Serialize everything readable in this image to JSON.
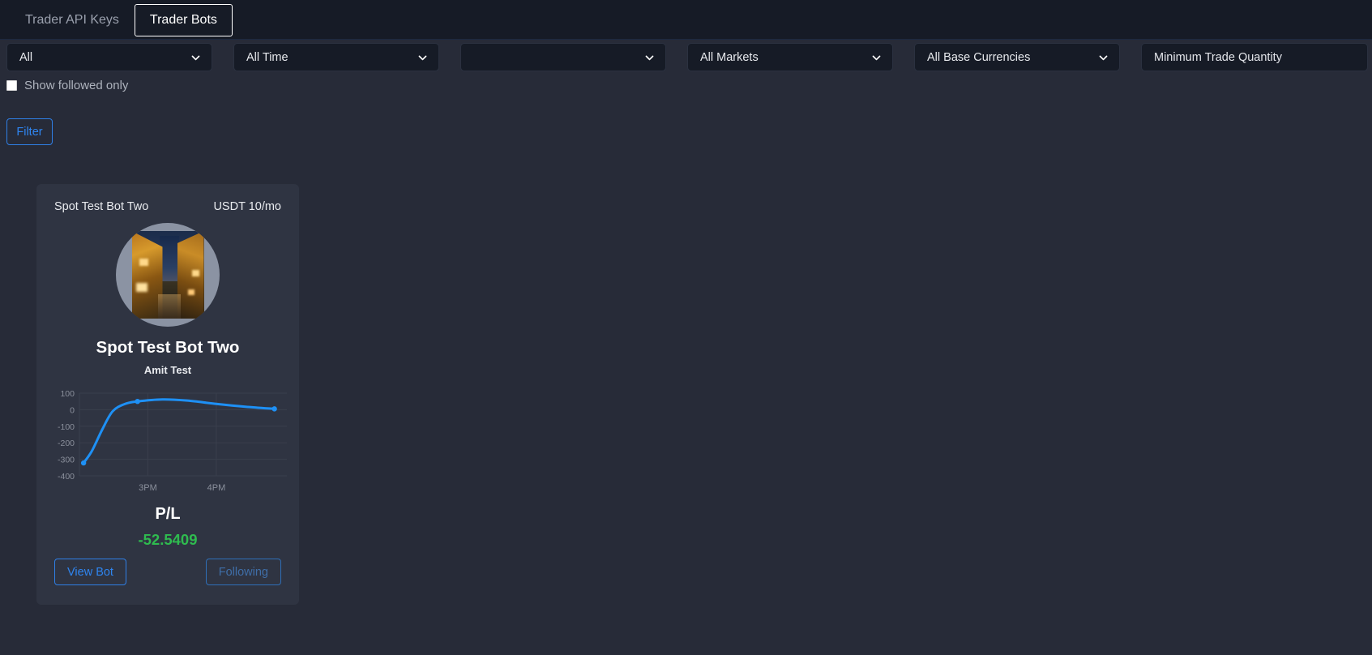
{
  "tabs": [
    {
      "label": "Trader API Keys",
      "active": false
    },
    {
      "label": "Trader Bots",
      "active": true
    }
  ],
  "filters": {
    "type_select": {
      "value": "All",
      "icon": "chevron-down-icon"
    },
    "time_select": {
      "value": "All Time",
      "icon": "chevron-down-icon"
    },
    "exchange_select": {
      "value": "",
      "icon": "chevron-down-icon"
    },
    "markets_select": {
      "value": "All Markets",
      "icon": "chevron-down-icon"
    },
    "base_currency_select": {
      "value": "All Base Currencies",
      "icon": "chevron-down-icon"
    },
    "min_trade_quantity_input": {
      "value": "",
      "placeholder": "Minimum Trade Quantity"
    },
    "show_followed_only": {
      "label": "Show followed only",
      "checked": false
    },
    "filter_button": "Filter"
  },
  "bot_card": {
    "header_name": "Spot Test Bot Two",
    "price": "USDT 10/mo",
    "avatar_alt": "city-street-night-photo",
    "name": "Spot Test Bot Two",
    "owner": "Amit Test",
    "pl_label": "P/L",
    "pl_value": "-52.5409",
    "pl_color": "#2fbb4f",
    "view_button": "View Bot",
    "follow_button": "Following"
  },
  "chart_data": {
    "type": "line",
    "title": "",
    "xlabel": "",
    "ylabel": "",
    "x_tick_labels": [
      "3PM",
      "4PM"
    ],
    "x_tick_positions": [
      0.33,
      0.66
    ],
    "y_ticks": [
      100,
      0,
      -100,
      -200,
      -300,
      -400
    ],
    "ylim": [
      -400,
      100
    ],
    "grid": true,
    "legend": false,
    "line_color": "#1e90f5",
    "series": [
      {
        "name": "P/L",
        "points": [
          {
            "x": 0.02,
            "y": -322
          },
          {
            "x": 0.06,
            "y": -250
          },
          {
            "x": 0.11,
            "y": -120
          },
          {
            "x": 0.16,
            "y": -10
          },
          {
            "x": 0.22,
            "y": 35
          },
          {
            "x": 0.28,
            "y": 50
          },
          {
            "x": 0.4,
            "y": 62
          },
          {
            "x": 0.52,
            "y": 55
          },
          {
            "x": 0.66,
            "y": 35
          },
          {
            "x": 0.8,
            "y": 18
          },
          {
            "x": 0.94,
            "y": 5
          }
        ],
        "markers": [
          {
            "x": 0.02,
            "y": -322
          },
          {
            "x": 0.28,
            "y": 50
          },
          {
            "x": 0.94,
            "y": 5
          }
        ]
      }
    ]
  }
}
